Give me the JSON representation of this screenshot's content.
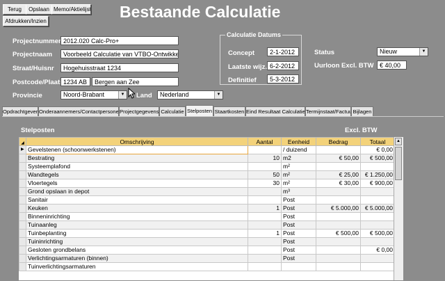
{
  "toolbar": {
    "back": "Terug",
    "save": "Opslaan",
    "memo": "Memo/Aktielijst",
    "print": "Afdrukken/Inzien"
  },
  "page_title": "Bestaande Calculatie",
  "project": {
    "nummer_label": "Projectnummer",
    "nummer": "2012.020 Calc-Pro+",
    "naam_label": "Projectnaam",
    "naam": "Voorbeeld Calculatie van VTBO-Ontwikkeling",
    "straat_label": "Straat/Huisnr",
    "straat": "Hogehuisstraat 1234",
    "postcode_label": "Postcode/Plaats",
    "postcode": "1234 AB",
    "plaats": "Bergen aan Zee",
    "provincie_label": "Provincie",
    "provincie": "Noord-Brabant",
    "land_label": "Land",
    "land": "Nederland"
  },
  "datums": {
    "group_title": "Calculatie Datums",
    "concept_label": "Concept",
    "concept": "2-1-2012",
    "laatste_label": "Laatste wijz.",
    "laatste": "6-2-2012",
    "definitief_label": "Definitief",
    "definitief": "5-3-2012"
  },
  "status": {
    "label": "Status",
    "value": "Nieuw",
    "uurloon_label": "Uurloon Excl. BTW",
    "uurloon": "€ 40,00"
  },
  "tabs": [
    {
      "label": "Opdrachtgever"
    },
    {
      "label": "Onderaannemers/Contactpersonen"
    },
    {
      "label": "Projectgegevens"
    },
    {
      "label": "Calculatie"
    },
    {
      "label": "Stelposten"
    },
    {
      "label": "Staartkosten"
    },
    {
      "label": "Eind Resultaat Calculatie"
    },
    {
      "label": "Termijnstaat/Factuur"
    },
    {
      "label": "Bijlagen"
    }
  ],
  "stelposten": {
    "heading": "Stelposten",
    "excl_btw": "Excl. BTW",
    "columns": [
      "Omschrijving",
      "Aantal",
      "Eenheid",
      "Bedrag",
      "Totaal"
    ],
    "rows": [
      [
        "Gevelstenen (schoonwerkstenen)",
        "",
        "/ duizend",
        "",
        "€ 0,00"
      ],
      [
        "Bestrating",
        "10",
        "m2",
        "€ 50,00",
        "€ 500,00"
      ],
      [
        "Systeemplafond",
        "",
        "m²",
        "",
        ""
      ],
      [
        "Wandtegels",
        "50",
        "m²",
        "€ 25,00",
        "€ 1.250,00"
      ],
      [
        "Vloertegels",
        "30",
        "m²",
        "€ 30,00",
        "€ 900,00"
      ],
      [
        "Grond opslaan in depot",
        "",
        "m³",
        "",
        ""
      ],
      [
        "Sanitair",
        "",
        "Post",
        "",
        ""
      ],
      [
        "Keuken",
        "1",
        "Post",
        "€ 5.000,00",
        "€ 5.000,00"
      ],
      [
        "Binneninrichting",
        "",
        "Post",
        "",
        ""
      ],
      [
        "Tuinaanleg",
        "",
        "Post",
        "",
        ""
      ],
      [
        "Tuinbeplanting",
        "1",
        "Post",
        "€ 500,00",
        "€ 500,00"
      ],
      [
        "Tuininrichting",
        "",
        "Post",
        "",
        ""
      ],
      [
        "Gesloten grondbelans",
        "",
        "Post",
        "",
        "€ 0,00"
      ],
      [
        "Verlichtingsarmaturen (binnen)",
        "",
        "Post",
        "",
        ""
      ],
      [
        "Tuinverlichtingsarmaturen",
        "",
        "",
        "",
        ""
      ]
    ]
  }
}
